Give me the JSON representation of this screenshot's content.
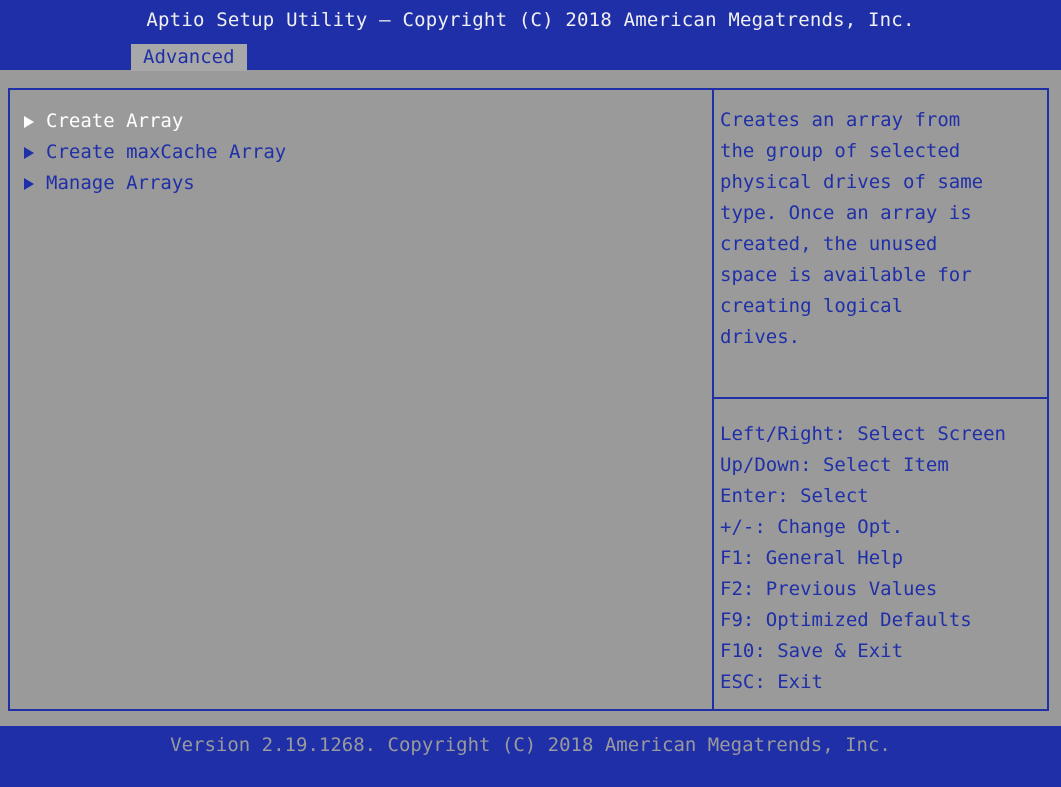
{
  "header": {
    "title": "Aptio Setup Utility – Copyright (C) 2018 American Megatrends, Inc.",
    "active_tab": "Advanced"
  },
  "menu": {
    "items": [
      {
        "label": "Create Array",
        "selected": true
      },
      {
        "label": "Create maxCache Array",
        "selected": false
      },
      {
        "label": "Manage Arrays",
        "selected": false
      }
    ]
  },
  "help": {
    "lines": [
      "Creates an array from",
      "the group of selected",
      "physical drives of same",
      "type. Once an array is",
      "created, the unused",
      "space is available for",
      "creating logical",
      "drives."
    ]
  },
  "keys": {
    "lines": [
      "Left/Right: Select Screen",
      "Up/Down: Select Item",
      "Enter: Select",
      "+/-: Change Opt.",
      "F1: General Help",
      "F2: Previous Values",
      "F9: Optimized Defaults",
      "F10: Save & Exit",
      "ESC: Exit"
    ]
  },
  "footer": {
    "version": "Version 2.19.1268. Copyright (C) 2018 American Megatrends, Inc."
  },
  "colors": {
    "blue": "#1f2fa8",
    "gray": "#9a9a9a",
    "selected_text": "#ffffff"
  }
}
